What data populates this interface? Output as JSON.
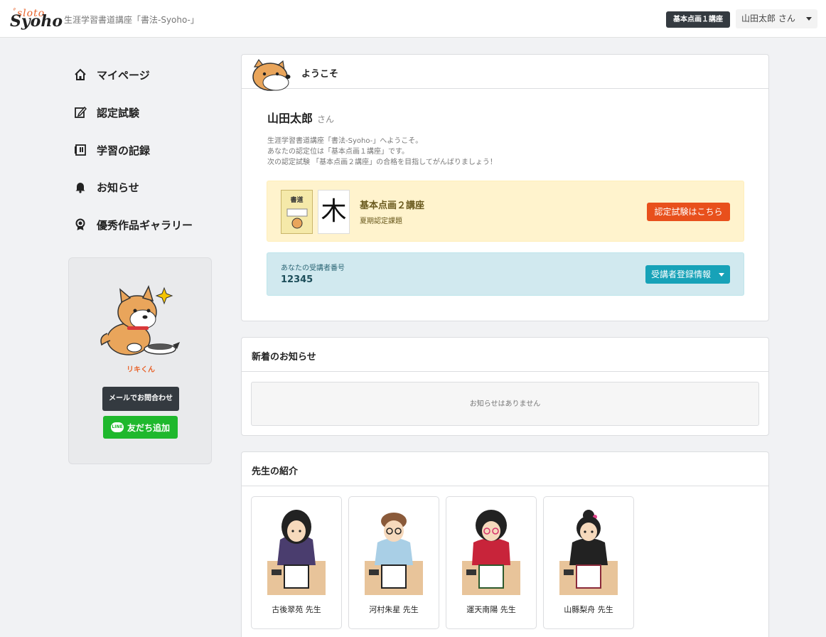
{
  "header": {
    "logo_top": "ﾟsloto",
    "logo_main": "Syoho",
    "site_title": "生涯学習書道講座「書法-Syoho-」",
    "level_badge": "基本点画１講座",
    "user_menu": "山田太郎 さん"
  },
  "sidebar": {
    "items": [
      {
        "label": "マイページ",
        "icon": "home-icon"
      },
      {
        "label": "認定試験",
        "icon": "edit-icon"
      },
      {
        "label": "学習の記録",
        "icon": "notebook-icon"
      },
      {
        "label": "お知らせ",
        "icon": "bell-icon"
      },
      {
        "label": "優秀作品ギャラリー",
        "icon": "award-icon"
      }
    ],
    "mascot_name": "リキくん",
    "mail_button": "メールでお問合わせ",
    "line_button": "友だち追加",
    "line_badge": "LINE"
  },
  "welcome": {
    "title": "ようこそ",
    "user_name": "山田太郎",
    "honorific": "さん",
    "intro_lines": [
      "生涯学習書道講座「書法-Syoho-」へようこそ。",
      "あなたの認定位は「基本点画１講座」です。",
      "次の認定試験 「基本点画２講座」の合格を目指してがんばりましょう！"
    ],
    "book_title": "書道",
    "kanji": "木",
    "lesson_title": "基本点画２講座",
    "lesson_sub": "夏期認定課題",
    "exam_button": "認定試験はこちら",
    "reg_label": "あなたの受講者番号",
    "reg_number": "12345",
    "reg_button": "受講者登録情報"
  },
  "news": {
    "title": "新着のお知らせ",
    "empty": "お知らせはありません"
  },
  "teachers": {
    "title": "先生の紹介",
    "items": [
      {
        "name": "古後翠苑 先生"
      },
      {
        "name": "河村朱星 先生"
      },
      {
        "name": "運天南陽 先生"
      },
      {
        "name": "山縣梨舟 先生"
      }
    ]
  },
  "colors": {
    "accent_orange": "#e8501c",
    "info_teal": "#17a2b8",
    "line_green": "#1fb82d",
    "dark": "#343a40"
  }
}
